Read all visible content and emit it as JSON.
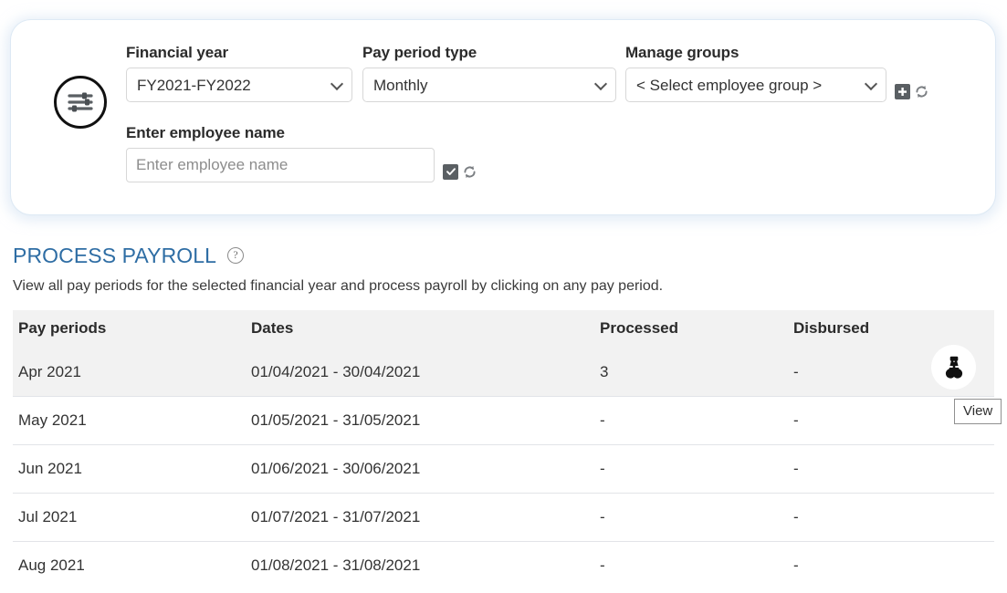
{
  "filter_panel": {
    "settings_icon": "sliders-icon",
    "financial_year": {
      "label": "Financial year",
      "value": "FY2021-FY2022",
      "options": [
        "FY2021-FY2022"
      ]
    },
    "pay_period_type": {
      "label": "Pay period type",
      "value": "Monthly",
      "options": [
        "Monthly"
      ]
    },
    "manage_groups": {
      "label": "Manage groups",
      "value": "< Select employee group >",
      "options": [
        "< Select employee group >"
      ],
      "add_icon": "plus-icon",
      "refresh_icon": "refresh-icon"
    },
    "employee_name": {
      "label": "Enter employee name",
      "value": "",
      "placeholder": "Enter employee name",
      "checkbox_icon": "checkbox-checked-icon",
      "refresh_icon": "refresh-icon"
    }
  },
  "section": {
    "title": "PROCESS PAYROLL",
    "help_icon": "question-mark-icon",
    "help_glyph": "?",
    "description": "View all pay periods for the selected financial year and process payroll by clicking on any pay period."
  },
  "table": {
    "columns": [
      "Pay periods",
      "Dates",
      "Processed",
      "Disbursed"
    ],
    "rows": [
      {
        "period": "Apr 2021",
        "dates": "01/04/2021 - 30/04/2021",
        "processed": "3",
        "disbursed": "-",
        "hovered": true
      },
      {
        "period": "May 2021",
        "dates": "01/05/2021 - 31/05/2021",
        "processed": "-",
        "disbursed": "-",
        "hovered": false
      },
      {
        "period": "Jun 2021",
        "dates": "01/06/2021 - 30/06/2021",
        "processed": "-",
        "disbursed": "-",
        "hovered": false
      },
      {
        "period": "Jul 2021",
        "dates": "01/07/2021 - 31/07/2021",
        "processed": "-",
        "disbursed": "-",
        "hovered": false
      },
      {
        "period": "Aug 2021",
        "dates": "01/08/2021 - 31/08/2021",
        "processed": "-",
        "disbursed": "-",
        "hovered": false
      }
    ]
  },
  "hover_action": {
    "icon": "binoculars-icon",
    "tooltip": "View"
  },
  "colors": {
    "section_title": "#2e6da4",
    "header_row_bg": "#f2f2f2",
    "hover_row_bg": "#f2f2f2",
    "panel_glow": "#dbe7f3",
    "icon_dark": "#5a5f63"
  }
}
